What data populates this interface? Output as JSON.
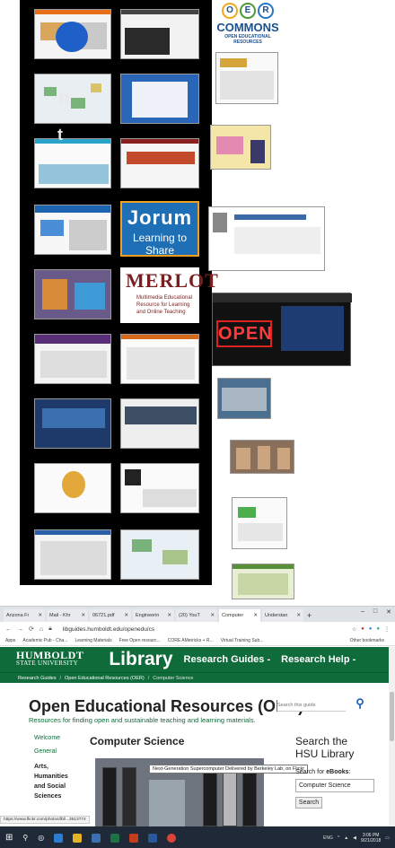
{
  "collage": {
    "oer_logo": {
      "letters": [
        "O",
        "E",
        "R"
      ],
      "word": "COMMONS",
      "sub": "OPEN EDUCATIONAL RESOURCES"
    },
    "jorum": {
      "title": "Jorum",
      "subtitle": "Learning to Share"
    },
    "merlot": {
      "title": "MERLOT",
      "subtitle": "Multimedia Educational Resource for Learning and Online Teaching"
    },
    "open_sign": "OPEN"
  },
  "browser": {
    "tabs": [
      {
        "label": "Arizona Fr",
        "active": false
      },
      {
        "label": "Mail - Khr",
        "active": false
      },
      {
        "label": "06721.pdf",
        "active": false
      },
      {
        "label": "Engineerin",
        "active": false
      },
      {
        "label": "(20) YouT",
        "active": false
      },
      {
        "label": "Computer",
        "active": true
      },
      {
        "label": "Understan",
        "active": false
      }
    ],
    "new_tab": "+",
    "window_controls": [
      "–",
      "□",
      "✕"
    ],
    "url": "libguides.humboldt.edu/openedu/cs",
    "bookmarks": [
      "Apps",
      "Academic Pub - Cha...",
      "Learning Materials",
      "Free Open resourc...",
      "CORE AMetricks + R...",
      "Virtual Training Sub..."
    ],
    "other_bookmarks": "Other bookmarks"
  },
  "site": {
    "logo_line1": "HUMBOLDT",
    "logo_line2": "STATE UNIVERSITY",
    "library": "Library",
    "nav": [
      "Research Guides -",
      "Research Help -"
    ],
    "breadcrumbs": [
      "Research Guides",
      "Open Educational Resources (OER)",
      "Computer Science"
    ],
    "guide_title": "Open Educational Resources (OER)",
    "guide_subtitle": "Resources for finding open and sustainable teaching and learning materials.",
    "search_placeholder": "Search this guide",
    "left_nav": [
      "Welcome",
      "General"
    ],
    "left_nav_active": [
      "Arts,",
      "Humanities",
      "and Social",
      "Sciences"
    ],
    "section_title": "Computer Science",
    "video_tooltip": "Next-Generation Supercomputer Delivered by Berkeley Lab, on Flickr",
    "search_heading_1": "Search the",
    "search_heading_2": "HSU Library",
    "search_label_prefix": "Search for ",
    "search_label_bold": "eBooks",
    "search_label_suffix": ":",
    "search_value": "Computer Science",
    "search_button": "Search",
    "status_url": "https://www.flickr.com/photos/lbl/...3513774"
  },
  "taskbar": {
    "clock_time": "3:06 PM",
    "clock_date": "9/21/2018",
    "lang": "ENG"
  },
  "colors": {
    "hsu_green": "#0f6b3a",
    "link_blue": "#1a5fb4",
    "jorum_blue": "#1e6fb5",
    "merlot_red": "#7a1f1f"
  }
}
